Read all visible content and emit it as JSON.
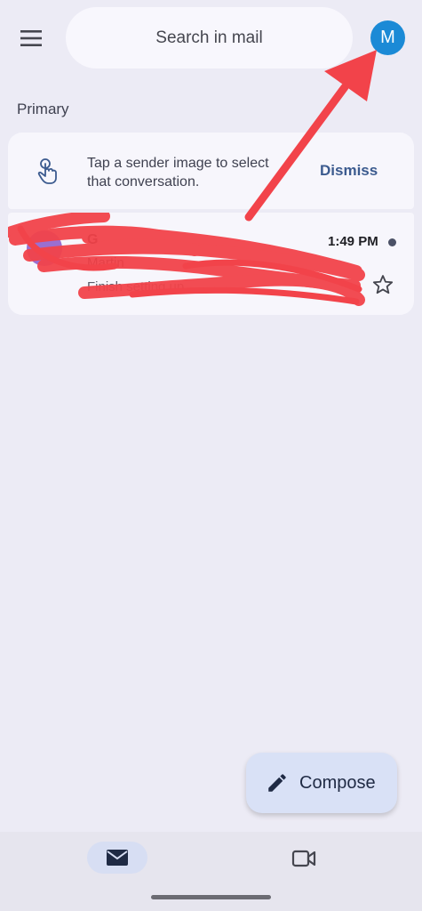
{
  "search": {
    "placeholder": "Search in mail"
  },
  "account": {
    "initial": "M",
    "color": "#1b8ad6"
  },
  "section": {
    "label": "Primary"
  },
  "tip": {
    "line1": "Tap a sender image to select",
    "line2": "that conversation.",
    "dismiss_label": "Dismiss",
    "icon": "touch-icon"
  },
  "email": {
    "sender": "G",
    "subject": "Martin",
    "snippet": "Finish setting up",
    "time": "1:49 PM",
    "unread": true
  },
  "compose": {
    "label": "Compose",
    "icon": "pencil-icon"
  },
  "bottom_nav": {
    "items": [
      {
        "name": "mail",
        "icon": "mail-icon",
        "selected": true
      },
      {
        "name": "meet",
        "icon": "video-icon",
        "selected": false
      }
    ]
  },
  "colors": {
    "background": "#ecebf5",
    "card": "#f7f6fc",
    "accent": "#3c5b8f",
    "annotation": "#f2434a",
    "compose_bg": "#d9e1f6"
  }
}
